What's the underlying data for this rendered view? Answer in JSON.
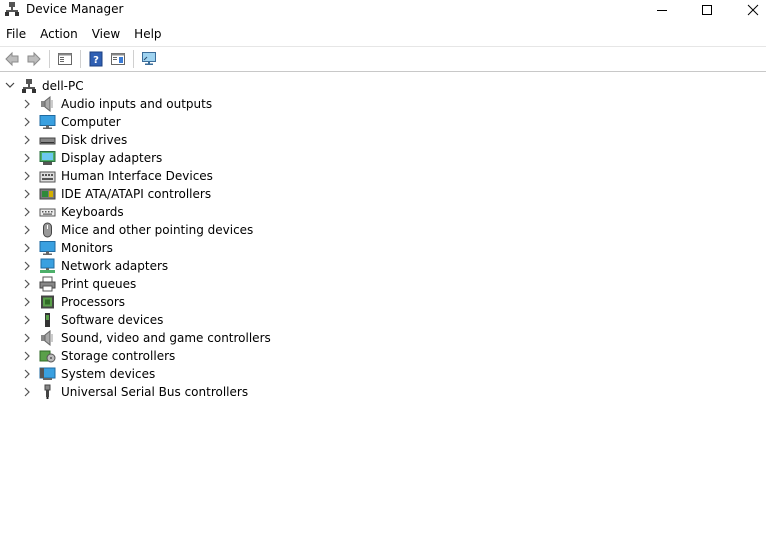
{
  "window": {
    "title": "Device Manager",
    "minimize_label": "Minimize",
    "maximize_label": "Maximize",
    "close_label": "Close"
  },
  "menu": {
    "items": [
      "File",
      "Action",
      "View",
      "Help"
    ]
  },
  "toolbar": {
    "buttons": [
      {
        "icon": "back-arrow-icon"
      },
      {
        "icon": "forward-arrow-icon"
      },
      {
        "icon": "properties-pane-icon"
      },
      {
        "icon": "help-icon"
      },
      {
        "icon": "update-driver-icon"
      },
      {
        "icon": "scan-monitor-icon"
      }
    ]
  },
  "tree": {
    "root": {
      "label": "dell-PC",
      "icon": "computer-network-icon",
      "expanded": true
    },
    "categories": [
      {
        "label": "Audio inputs and outputs",
        "icon": "speaker-icon"
      },
      {
        "label": "Computer",
        "icon": "computer-icon"
      },
      {
        "label": "Disk drives",
        "icon": "disk-drive-icon"
      },
      {
        "label": "Display adapters",
        "icon": "display-adapter-icon"
      },
      {
        "label": "Human Interface Devices",
        "icon": "hid-icon"
      },
      {
        "label": "IDE ATA/ATAPI controllers",
        "icon": "ide-controller-icon"
      },
      {
        "label": "Keyboards",
        "icon": "keyboard-icon"
      },
      {
        "label": "Mice and other pointing devices",
        "icon": "mouse-icon"
      },
      {
        "label": "Monitors",
        "icon": "monitor-icon"
      },
      {
        "label": "Network adapters",
        "icon": "network-adapter-icon"
      },
      {
        "label": "Print queues",
        "icon": "printer-icon"
      },
      {
        "label": "Processors",
        "icon": "processor-icon"
      },
      {
        "label": "Software devices",
        "icon": "software-device-icon"
      },
      {
        "label": "Sound, video and game controllers",
        "icon": "sound-controller-icon"
      },
      {
        "label": "Storage controllers",
        "icon": "storage-controller-icon"
      },
      {
        "label": "System devices",
        "icon": "system-device-icon"
      },
      {
        "label": "Universal Serial Bus controllers",
        "icon": "usb-icon"
      }
    ]
  }
}
